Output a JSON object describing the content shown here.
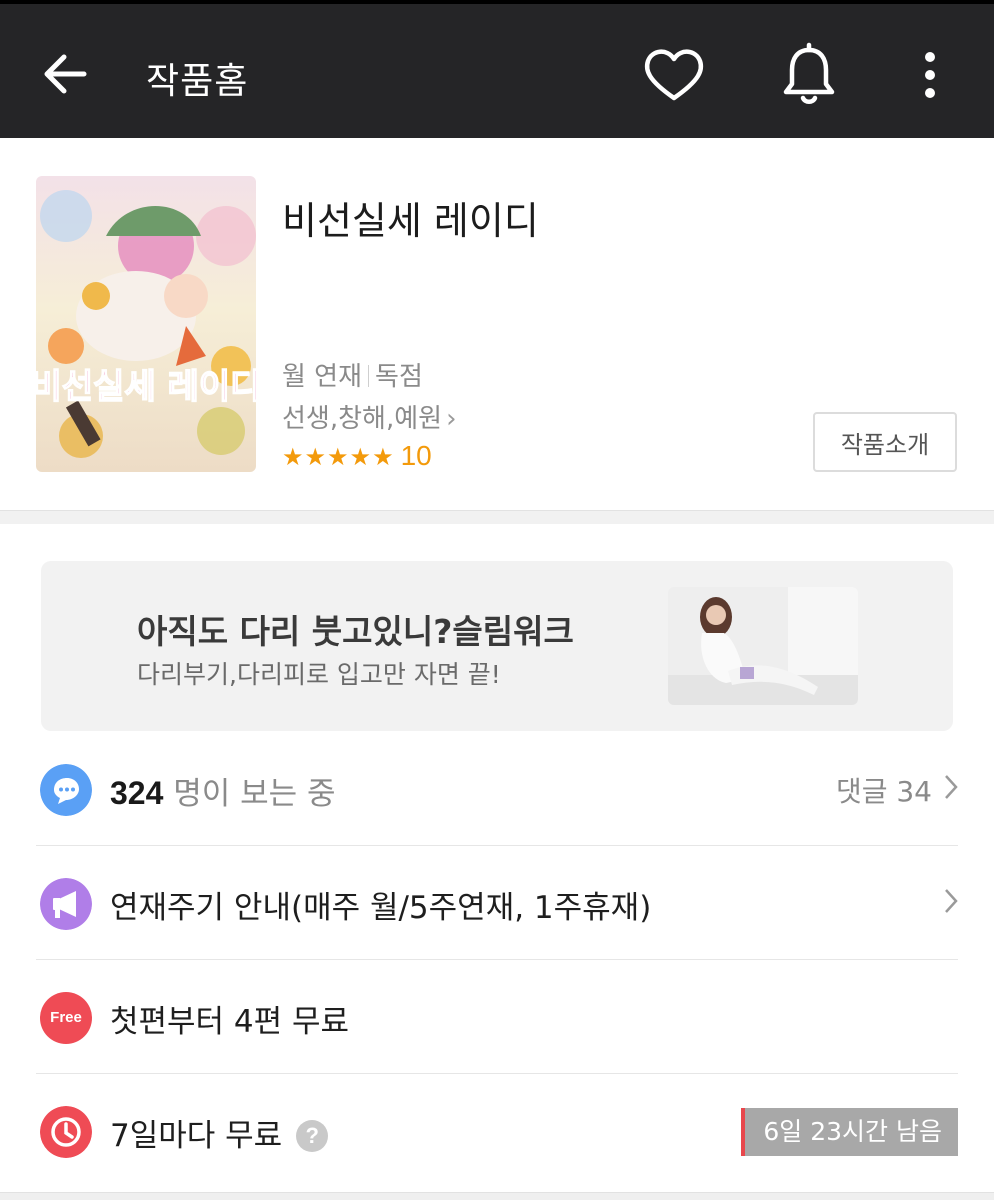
{
  "header": {
    "title": "작품홈",
    "icons": {
      "back": "arrow-left-icon",
      "like": "heart-icon",
      "alarm": "bell-icon",
      "more": "more-vertical-icon"
    },
    "background_color": "#252527"
  },
  "work": {
    "title": "비선실세 레이디",
    "cover_title_art": "비선실세 레이디",
    "schedule": "월 연재",
    "exclusive": "독점",
    "authors": "선생,창해,예원",
    "stars": "★★★★★",
    "rating": "10",
    "intro_button": "작품소개",
    "accent_color": "#f39a0b"
  },
  "ad": {
    "headline": "아직도 다리 붓고있니?슬림워크",
    "subtext": "다리부기,다리피로 입고만 자면 끝!"
  },
  "rows": {
    "viewers": {
      "count": "324",
      "label": "명이 보는 중",
      "comments": "댓글 34",
      "icon": "chat-bubble-icon",
      "icon_color": "#5aa0f5"
    },
    "notice": {
      "text": "연재주기 안내(매주 월/5주연재, 1주휴재)",
      "icon": "megaphone-icon",
      "icon_color": "#b07ee8"
    },
    "free": {
      "icon_text": "Free",
      "text": "첫편부터 4편 무료",
      "icon_color": "#ef4b55"
    },
    "wait_free": {
      "text": "7일마다 무료",
      "help": "?",
      "remaining": "6일 23시간 남음",
      "icon": "clock-icon",
      "icon_color": "#ef4b55"
    }
  }
}
